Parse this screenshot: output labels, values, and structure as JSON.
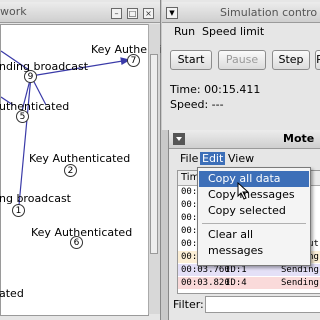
{
  "network": {
    "title": "work",
    "nodes": [
      {
        "id": "7",
        "label": "Key Authenticated"
      },
      {
        "id": "9",
        "label": "nding broadcast"
      },
      {
        "id": "5",
        "label": "uthenticated"
      },
      {
        "id": "2",
        "label": "Key Authenticated"
      },
      {
        "id": "1",
        "label": "ng broadcast"
      },
      {
        "id": "6",
        "label": "Key Authenticated"
      }
    ],
    "bottom_label": "ated"
  },
  "sim": {
    "title": "Simulation contro",
    "menu": [
      "Run",
      "Speed limit"
    ],
    "buttons": {
      "start": "Start",
      "pause": "Pause",
      "step": "Step",
      "reload": "R"
    },
    "time": "Time: 00:15.411",
    "speed": "Speed: ---"
  },
  "mote": {
    "title": "Mote",
    "menu": {
      "file": "File",
      "edit": "Edit",
      "view": "View"
    },
    "table": {
      "header_time": "Time",
      "rows": [
        {
          "time": "00:0",
          "id": "",
          "msg": "",
          "color": "#ffffff"
        },
        {
          "time": "00:0",
          "id": "",
          "msg": "",
          "color": "#ffffff"
        },
        {
          "time": "00:0",
          "id": "",
          "msg": "",
          "color": "#ffffff"
        },
        {
          "time": "00:0",
          "id": "",
          "msg": "",
          "color": "#ffffff"
        },
        {
          "time": "00:03.680",
          "id": "ID:6",
          "msg": "Key Aut",
          "color": "#ffffff"
        },
        {
          "time": "00:03.686",
          "id": "ID:9",
          "msg": "Sending",
          "color": "#fcefd6"
        },
        {
          "time": "00:03.760",
          "id": "ID:1",
          "msg": "Sending",
          "color": "#e4e0f7"
        },
        {
          "time": "00:03.820",
          "id": "ID:4",
          "msg": "Sending",
          "color": "#fadada"
        }
      ]
    },
    "filter_label": "Filter:"
  },
  "dropdown": {
    "items": [
      "Copy all data",
      "Copy messages",
      "Copy selected",
      "Clear all messages"
    ],
    "highlighted_index": 0
  },
  "colors": {
    "menu_highlight": "#3d6fb8",
    "link_line": "#3a3aa8"
  }
}
